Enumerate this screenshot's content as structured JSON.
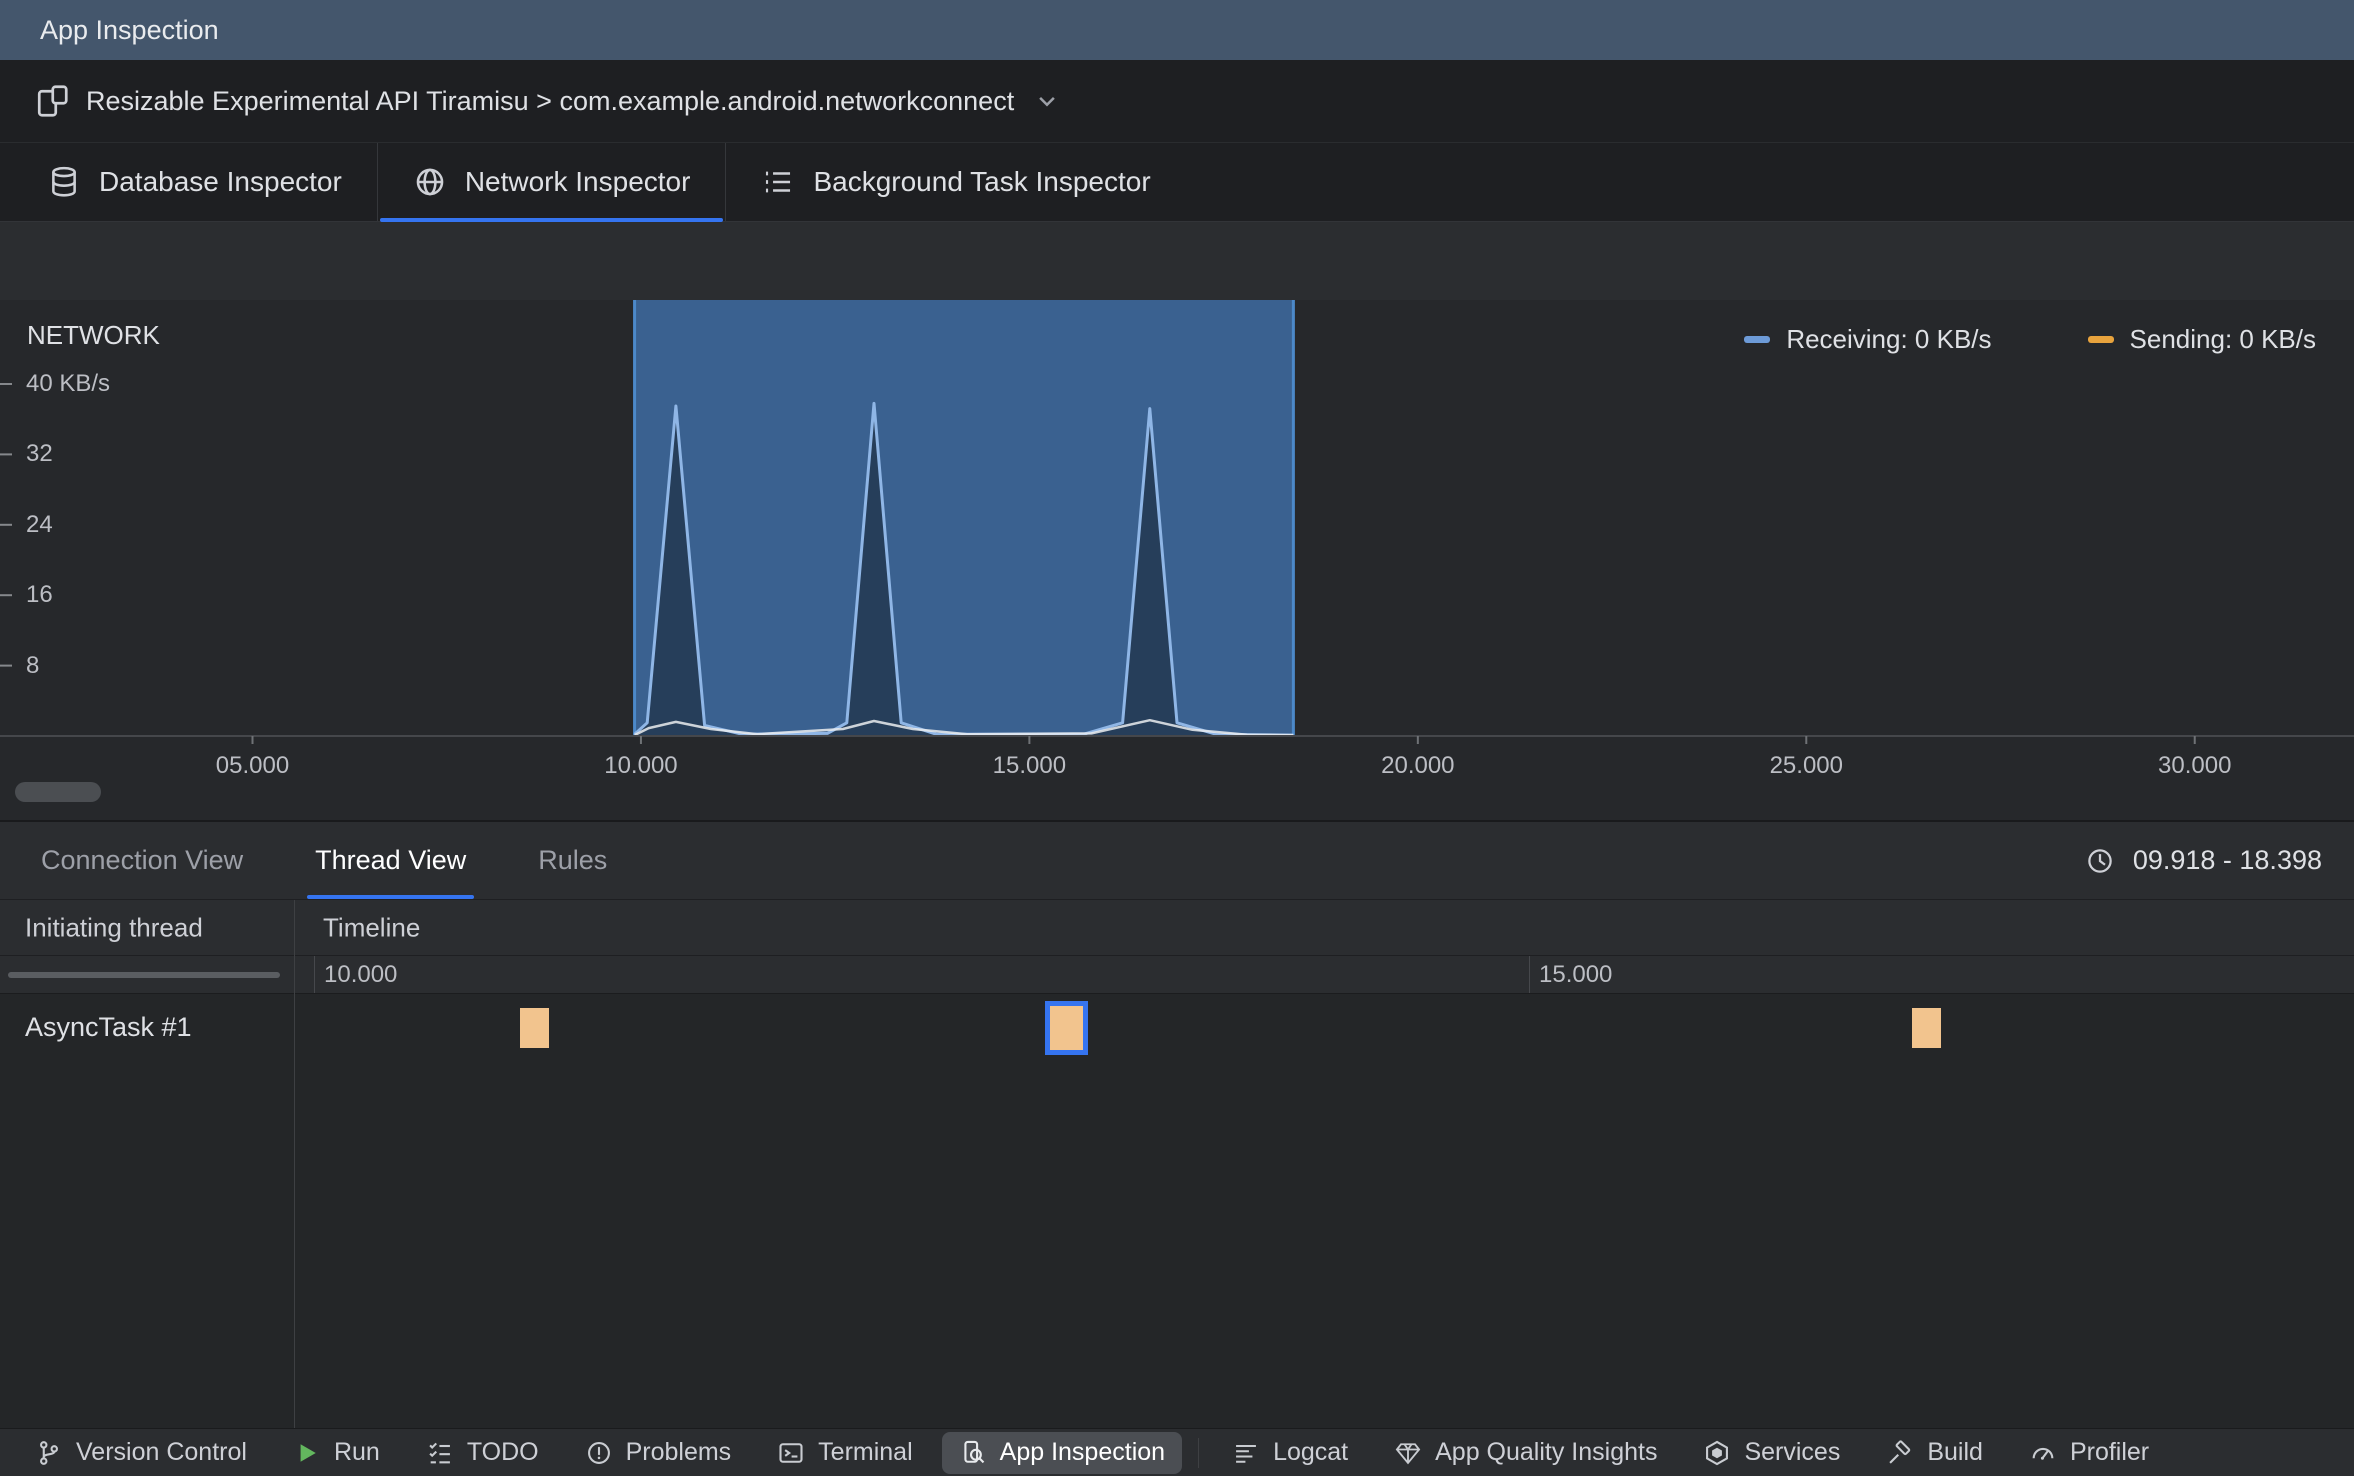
{
  "accent_color": "#3574F0",
  "title_bar": {
    "title": "App Inspection"
  },
  "device_bar": {
    "label": "Resizable Experimental API Tiramisu > com.example.android.networkconnect"
  },
  "inspector_tabs": [
    {
      "label": "Database Inspector",
      "active": false
    },
    {
      "label": "Network Inspector",
      "active": true
    },
    {
      "label": "Background Task Inspector",
      "active": false
    }
  ],
  "network_chart": {
    "label": "NETWORK",
    "type": "line",
    "x_axis": {
      "unit": "seconds",
      "visible_range": [
        1.75,
        32.05
      ],
      "ticks": [
        {
          "value": 5,
          "label": "05.000"
        },
        {
          "value": 10,
          "label": "10.000"
        },
        {
          "value": 15,
          "label": "15.000"
        },
        {
          "value": 20,
          "label": "20.000"
        },
        {
          "value": 25,
          "label": "25.000"
        },
        {
          "value": 30,
          "label": "30.000"
        }
      ]
    },
    "y_axis": {
      "unit": "KB/s",
      "max": 40,
      "ticks": [
        {
          "value": 40,
          "label": "40 KB/s"
        },
        {
          "value": 32,
          "label": "32"
        },
        {
          "value": 24,
          "label": "24"
        },
        {
          "value": 16,
          "label": "16"
        },
        {
          "value": 8,
          "label": "8"
        }
      ]
    },
    "legend": [
      {
        "label": "Receiving: 0 KB/s",
        "color": "#6D9BD8"
      },
      {
        "label": "Sending: 0 KB/s",
        "color": "#E8A33D"
      }
    ],
    "selection": {
      "start": 9.918,
      "end": 18.398,
      "fill": "#3A6190",
      "edge": "#4C89C9"
    },
    "series": [
      {
        "name": "Receiving",
        "color": "#8FB6E6",
        "points": [
          [
            9.918,
            0.2
          ],
          [
            10.08,
            1.5
          ],
          [
            10.45,
            37.5
          ],
          [
            10.82,
            1.2
          ],
          [
            11.3,
            0.2
          ],
          [
            12.4,
            0.3
          ],
          [
            12.65,
            1.5
          ],
          [
            13.0,
            37.8
          ],
          [
            13.35,
            1.5
          ],
          [
            13.8,
            0.2
          ],
          [
            15.7,
            0.2
          ],
          [
            16.2,
            1.5
          ],
          [
            16.55,
            37.2
          ],
          [
            16.9,
            1.5
          ],
          [
            17.4,
            0.2
          ],
          [
            18.398,
            0.1
          ]
        ]
      },
      {
        "name": "Sending",
        "color": "rgba(235,237,240,0.85)",
        "points": [
          [
            9.918,
            0.1
          ],
          [
            10.1,
            0.9
          ],
          [
            10.45,
            1.6
          ],
          [
            10.9,
            0.8
          ],
          [
            11.5,
            0.2
          ],
          [
            12.6,
            0.8
          ],
          [
            13.0,
            1.7
          ],
          [
            13.5,
            0.8
          ],
          [
            14.2,
            0.2
          ],
          [
            15.8,
            0.3
          ],
          [
            16.55,
            1.8
          ],
          [
            17.1,
            0.7
          ],
          [
            17.8,
            0.15
          ],
          [
            18.398,
            0.1
          ]
        ]
      }
    ]
  },
  "thread_panel": {
    "tabs": [
      {
        "label": "Connection View",
        "active": false
      },
      {
        "label": "Thread View",
        "active": true
      },
      {
        "label": "Rules",
        "active": false
      }
    ],
    "time_range_label": "09.918 - 18.398",
    "columns": {
      "thread": "Initiating thread",
      "timeline": "Timeline"
    },
    "timeline_range": [
      9.918,
      18.398
    ],
    "timeline_ticks": [
      {
        "value": 10,
        "label": "10.000"
      },
      {
        "value": 15,
        "label": "15.000"
      }
    ],
    "rows": [
      {
        "thread": "AsyncTask #1",
        "events": [
          {
            "start": 10.85,
            "end": 10.97,
            "selected": false
          },
          {
            "start": 13.04,
            "end": 13.16,
            "selected": true
          },
          {
            "start": 16.58,
            "end": 16.7,
            "selected": false
          }
        ]
      }
    ],
    "event_color": "#F2C48E",
    "selected_border": "#3574F0"
  },
  "bottom_bar": {
    "items": [
      {
        "label": "Version Control",
        "active": false
      },
      {
        "label": "Run",
        "active": false
      },
      {
        "label": "TODO",
        "active": false
      },
      {
        "label": "Problems",
        "active": false
      },
      {
        "label": "Terminal",
        "active": false
      },
      {
        "label": "App Inspection",
        "active": true
      },
      {
        "label": "Logcat",
        "active": false
      },
      {
        "label": "App Quality Insights",
        "active": false
      },
      {
        "label": "Services",
        "active": false
      },
      {
        "label": "Build",
        "active": false
      },
      {
        "label": "Profiler",
        "active": false
      }
    ]
  }
}
